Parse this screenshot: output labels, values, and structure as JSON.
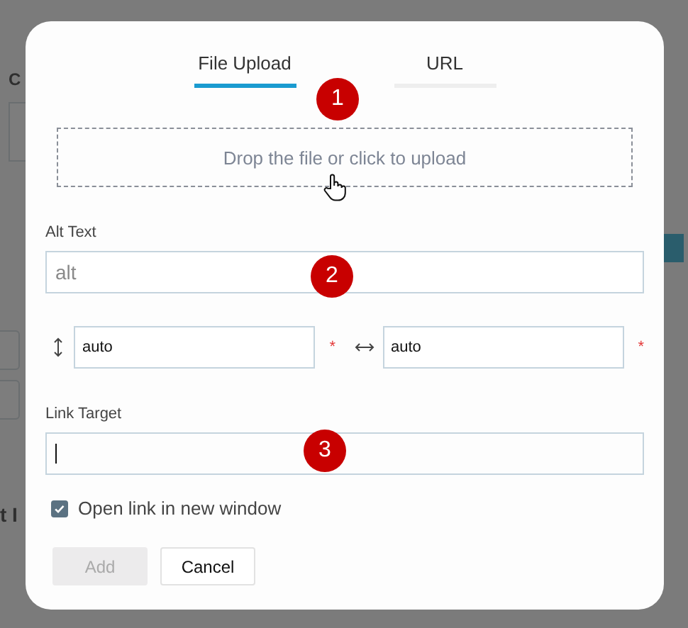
{
  "background": {
    "texts": [
      "C",
      "t I"
    ]
  },
  "dialog": {
    "tabs": [
      {
        "label": "File Upload",
        "selected": true
      },
      {
        "label": "URL",
        "selected": false
      }
    ],
    "dropzone": {
      "text": "Drop the file or click to upload"
    },
    "alt_text": {
      "label": "Alt Text",
      "placeholder": "alt"
    },
    "size_fields": [
      {
        "kind": "height",
        "value": "auto",
        "required_mark": "*"
      },
      {
        "kind": "width",
        "value": "auto",
        "required_mark": "*"
      }
    ],
    "link_target": {
      "label": "Link Target",
      "focused": true
    },
    "open_new_window": {
      "label": "Open link in new window",
      "checked": true
    },
    "buttons": [
      {
        "label": "Add",
        "disabled": true
      },
      {
        "label": "Cancel",
        "disabled": false
      }
    ]
  },
  "markers": [
    "1",
    "2",
    "3"
  ]
}
